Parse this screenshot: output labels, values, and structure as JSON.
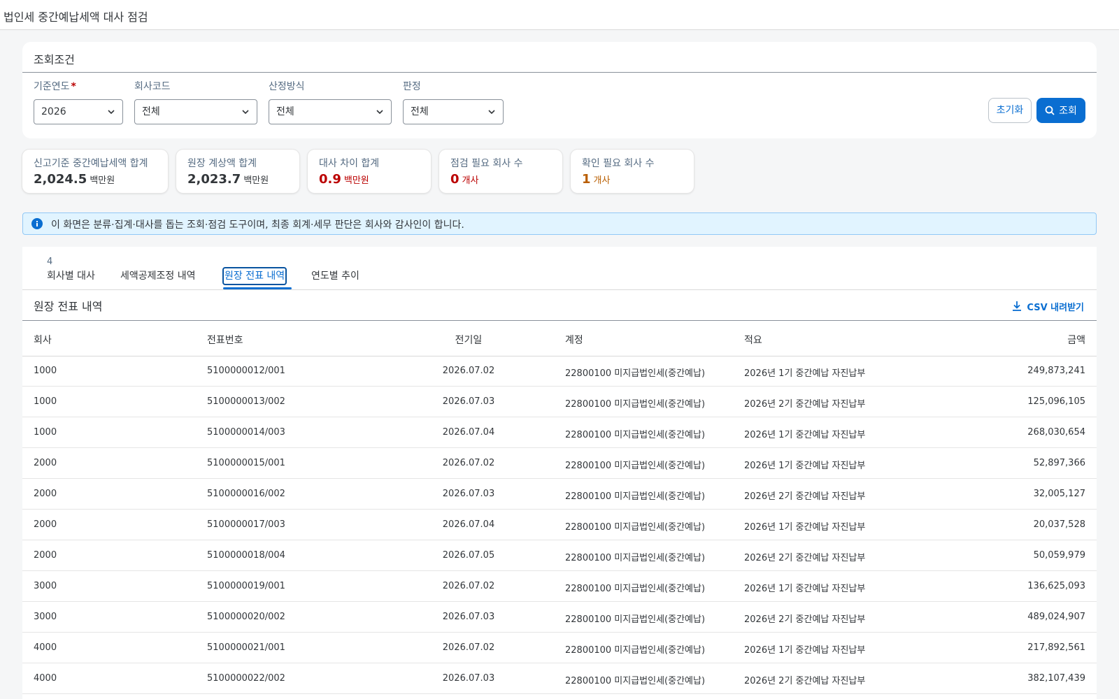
{
  "app": {
    "title": "법인세 중간예납세액 대사 점검"
  },
  "filters": {
    "title": "조회조건",
    "fields": [
      {
        "label": "기준연도",
        "required": "*",
        "value": "2026"
      },
      {
        "label": "회사코드",
        "value": "전체"
      },
      {
        "label": "산정방식",
        "value": "전체"
      },
      {
        "label": "판정",
        "value": "전체"
      }
    ],
    "reset_label": "초기화",
    "search_label": "조회"
  },
  "kpis": [
    {
      "label": "신고기준 중간예납세액 합계",
      "value": "2,024.5",
      "unit": "백만원",
      "color": "#32363a"
    },
    {
      "label": "원장 계상액 합계",
      "value": "2,023.7",
      "unit": "백만원",
      "color": "#32363a"
    },
    {
      "label": "대사 차이 합계",
      "value": "0.9",
      "unit": "백만원",
      "color": "#bb0000"
    },
    {
      "label": "점검 필요 회사 수",
      "value": "0",
      "unit": "개사",
      "color": "#bb0000"
    },
    {
      "label": "확인 필요 회사 수",
      "value": "1",
      "unit": "개사",
      "color": "#b95e00"
    }
  ],
  "info": {
    "text": "이 화면은 분류·집계·대사를 돕는 조회·점검 도구이며, 최종 회계·세무 판단은 회사와 감사인이 합니다."
  },
  "tabs": {
    "count": "4",
    "items": [
      {
        "label": "회사별 대사"
      },
      {
        "label": "세액공제조정 내역"
      },
      {
        "label": "원장 전표 내역"
      },
      {
        "label": "연도별 추이"
      }
    ],
    "selected_index": 2
  },
  "table": {
    "title": "원장 전표 내역",
    "csv_label": "CSV 내려받기",
    "columns": [
      "회사",
      "전표번호",
      "전기일",
      "계정",
      "적요",
      "금액"
    ],
    "rows": [
      [
        "1000",
        "5100000012/001",
        "2026.07.02",
        "22800100 미지급법인세(중간예납)",
        "2026년 1기 중간예납 자진납부",
        "249,873,241"
      ],
      [
        "1000",
        "5100000013/002",
        "2026.07.03",
        "22800100 미지급법인세(중간예납)",
        "2026년 2기 중간예납 자진납부",
        "125,096,105"
      ],
      [
        "1000",
        "5100000014/003",
        "2026.07.04",
        "22800100 미지급법인세(중간예납)",
        "2026년 1기 중간예납 자진납부",
        "268,030,654"
      ],
      [
        "2000",
        "5100000015/001",
        "2026.07.02",
        "22800100 미지급법인세(중간예납)",
        "2026년 1기 중간예납 자진납부",
        "52,897,366"
      ],
      [
        "2000",
        "5100000016/002",
        "2026.07.03",
        "22800100 미지급법인세(중간예납)",
        "2026년 2기 중간예납 자진납부",
        "32,005,127"
      ],
      [
        "2000",
        "5100000017/003",
        "2026.07.04",
        "22800100 미지급법인세(중간예납)",
        "2026년 1기 중간예납 자진납부",
        "20,037,528"
      ],
      [
        "2000",
        "5100000018/004",
        "2026.07.05",
        "22800100 미지급법인세(중간예납)",
        "2026년 2기 중간예납 자진납부",
        "50,059,979"
      ],
      [
        "3000",
        "5100000019/001",
        "2026.07.02",
        "22800100 미지급법인세(중간예납)",
        "2026년 1기 중간예납 자진납부",
        "136,625,093"
      ],
      [
        "3000",
        "5100000020/002",
        "2026.07.03",
        "22800100 미지급법인세(중간예납)",
        "2026년 2기 중간예납 자진납부",
        "489,024,907"
      ],
      [
        "4000",
        "5100000021/001",
        "2026.07.02",
        "22800100 미지급법인세(중간예납)",
        "2026년 1기 중간예납 자진납부",
        "217,892,561"
      ],
      [
        "4000",
        "5100000022/002",
        "2026.07.03",
        "22800100 미지급법인세(중간예납)",
        "2026년 2기 중간예납 자진납부",
        "382,107,439"
      ]
    ]
  },
  "icons": {
    "select": "chevron-down-icon",
    "search": "search-icon",
    "info": "info-icon",
    "download": "download-icon"
  },
  "colors": {
    "accent": "#0a6ed1",
    "negative": "#bb0000",
    "critical": "#b95e00",
    "info_bg": "#e1f4ff"
  }
}
